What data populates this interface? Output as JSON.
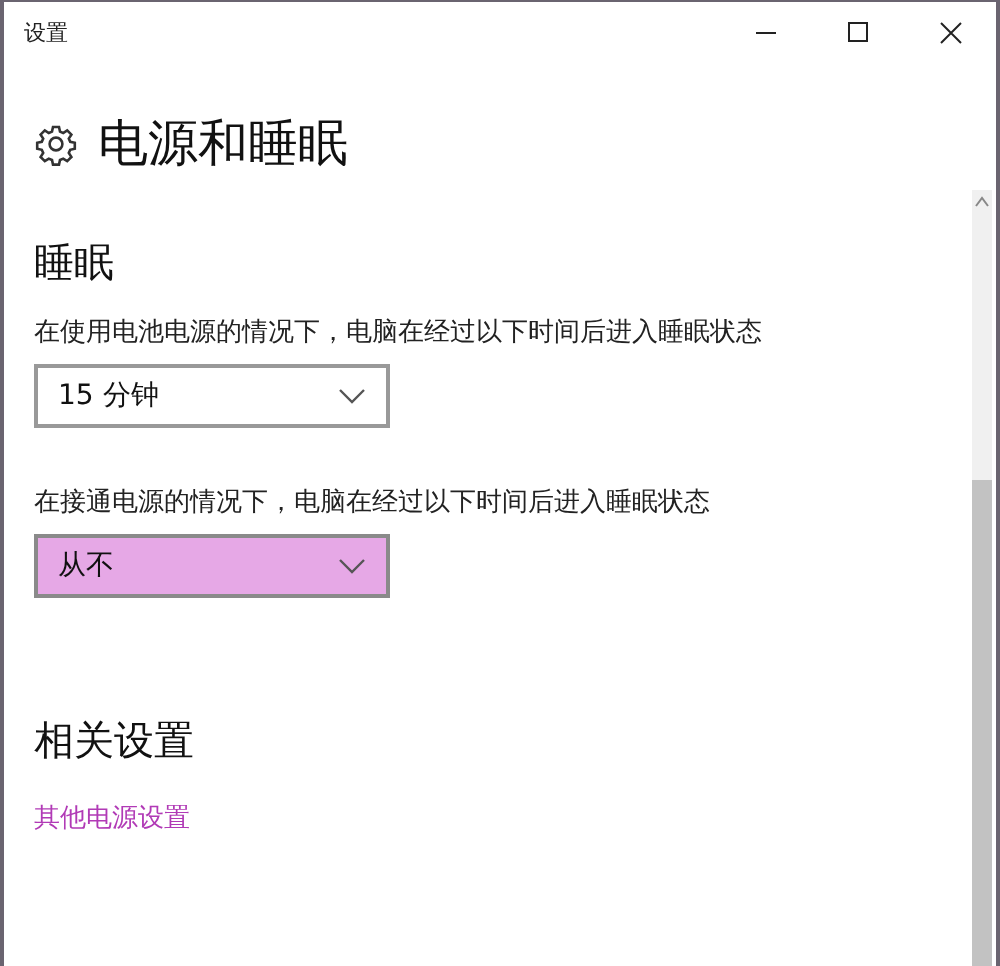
{
  "window": {
    "title": "设置",
    "controls": [
      {
        "kind": "minimize"
      },
      {
        "kind": "maximize"
      },
      {
        "kind": "close"
      }
    ]
  },
  "page": {
    "title": "电源和睡眠"
  },
  "sleep": {
    "heading": "睡眠",
    "settings": [
      {
        "label": "在使用电池电源的情况下，电脑在经过以下时间后进入睡眠状态",
        "value": "15 分钟",
        "highlighted": false
      },
      {
        "label": "在接通电源的情况下，电脑在经过以下时间后进入睡眠状态",
        "value": "从不",
        "highlighted": true
      }
    ]
  },
  "related": {
    "heading": "相关设置",
    "links": [
      "其他电源设置"
    ]
  }
}
